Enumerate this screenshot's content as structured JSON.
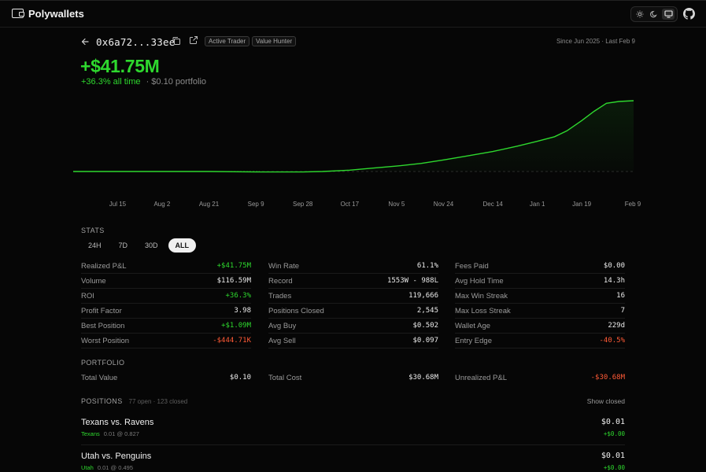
{
  "app": {
    "name": "Polywallets"
  },
  "header": {
    "wallet_address": "0x6a72...33ee",
    "tags": [
      "Active Trader",
      "Value Hunter"
    ],
    "since": "Since Jun 2025 · Last Feb 9",
    "pnl": "+$41.75M",
    "pct_all_time": "+36.3% all time",
    "portfolio_sub": "· $0.10 portfolio"
  },
  "colors": {
    "positive": "#2ed82e",
    "negative": "#ff5a36",
    "background": "#060606"
  },
  "icons": {
    "brand": "wallet-icon",
    "theme": [
      "sun-icon",
      "moon-icon",
      "monitor-icon"
    ],
    "github": "github-icon",
    "back": "arrow-left-icon",
    "copy": "copy-icon",
    "external": "external-link-icon"
  },
  "chart_data": {
    "type": "area",
    "x_ticks": [
      "Jul 15",
      "Aug 2",
      "Aug 21",
      "Sep 9",
      "Sep 28",
      "Oct 17",
      "Nov 5",
      "Nov 24",
      "Dec 14",
      "Jan 1",
      "Jan 19",
      "Feb 9"
    ],
    "x": [
      "Jun 27",
      "Jul 15",
      "Aug 2",
      "Aug 21",
      "Sep 9",
      "Sep 28",
      "Oct 6",
      "Oct 17",
      "Oct 25",
      "Nov 5",
      "Nov 15",
      "Nov 24",
      "Dec 3",
      "Dec 14",
      "Dec 24",
      "Jan 1",
      "Jan 8",
      "Jan 13",
      "Jan 19",
      "Jan 24",
      "Jan 29",
      "Feb 3",
      "Feb 9"
    ],
    "y": [
      0,
      0,
      0,
      0,
      -0.3,
      -0.3,
      0,
      0.8,
      1.8,
      3.2,
      4.8,
      6.8,
      9.0,
      11.8,
      15.0,
      17.8,
      20.5,
      24.0,
      30.0,
      35.5,
      40.2,
      41.3,
      41.75
    ],
    "baseline": 0,
    "series_color": "#2ed82e",
    "grid": false
  },
  "stats": {
    "label": "STATS",
    "periods": [
      "24H",
      "7D",
      "30D",
      "ALL"
    ],
    "active_period": "ALL",
    "columns": [
      [
        {
          "label": "Realized P&L",
          "value": "+$41.75M",
          "tone": "green"
        },
        {
          "label": "Volume",
          "value": "$116.59M",
          "tone": ""
        },
        {
          "label": "ROI",
          "value": "+36.3%",
          "tone": "green"
        },
        {
          "label": "Profit Factor",
          "value": "3.98",
          "tone": ""
        },
        {
          "label": "Best Position",
          "value": "+$1.09M",
          "tone": "green"
        },
        {
          "label": "Worst Position",
          "value": "-$444.71K",
          "tone": "red"
        }
      ],
      [
        {
          "label": "Win Rate",
          "value": "61.1%",
          "tone": ""
        },
        {
          "label": "Record",
          "value": "1553W - 988L",
          "tone": ""
        },
        {
          "label": "Trades",
          "value": "119,666",
          "tone": ""
        },
        {
          "label": "Positions Closed",
          "value": "2,545",
          "tone": ""
        },
        {
          "label": "Avg Buy",
          "value": "$0.502",
          "tone": ""
        },
        {
          "label": "Avg Sell",
          "value": "$0.097",
          "tone": ""
        }
      ],
      [
        {
          "label": "Fees Paid",
          "value": "$0.00",
          "tone": ""
        },
        {
          "label": "Avg Hold Time",
          "value": "14.3h",
          "tone": ""
        },
        {
          "label": "Max Win Streak",
          "value": "16",
          "tone": ""
        },
        {
          "label": "Max Loss Streak",
          "value": "7",
          "tone": ""
        },
        {
          "label": "Wallet Age",
          "value": "229d",
          "tone": ""
        },
        {
          "label": "Entry Edge",
          "value": "-40.5%",
          "tone": "red"
        }
      ]
    ]
  },
  "portfolio": {
    "label": "PORTFOLIO",
    "items": [
      {
        "label": "Total Value",
        "value": "$0.10",
        "tone": ""
      },
      {
        "label": "Total Cost",
        "value": "$30.68M",
        "tone": ""
      },
      {
        "label": "Unrealized P&L",
        "value": "-$30.68M",
        "tone": "red"
      }
    ]
  },
  "positions": {
    "label": "POSITIONS",
    "count": "77 open · 123 closed",
    "show_closed": "Show closed",
    "items": [
      {
        "title": "Texans vs. Ravens",
        "outcome": "Texans",
        "detail": "0.01 @ 0.827",
        "value": "$0.01",
        "pnl": "+$0.00"
      },
      {
        "title": "Utah vs. Penguins",
        "outcome": "Utah",
        "detail": "0.01 @ 0.495",
        "value": "$0.01",
        "pnl": "+$0.00"
      }
    ]
  }
}
